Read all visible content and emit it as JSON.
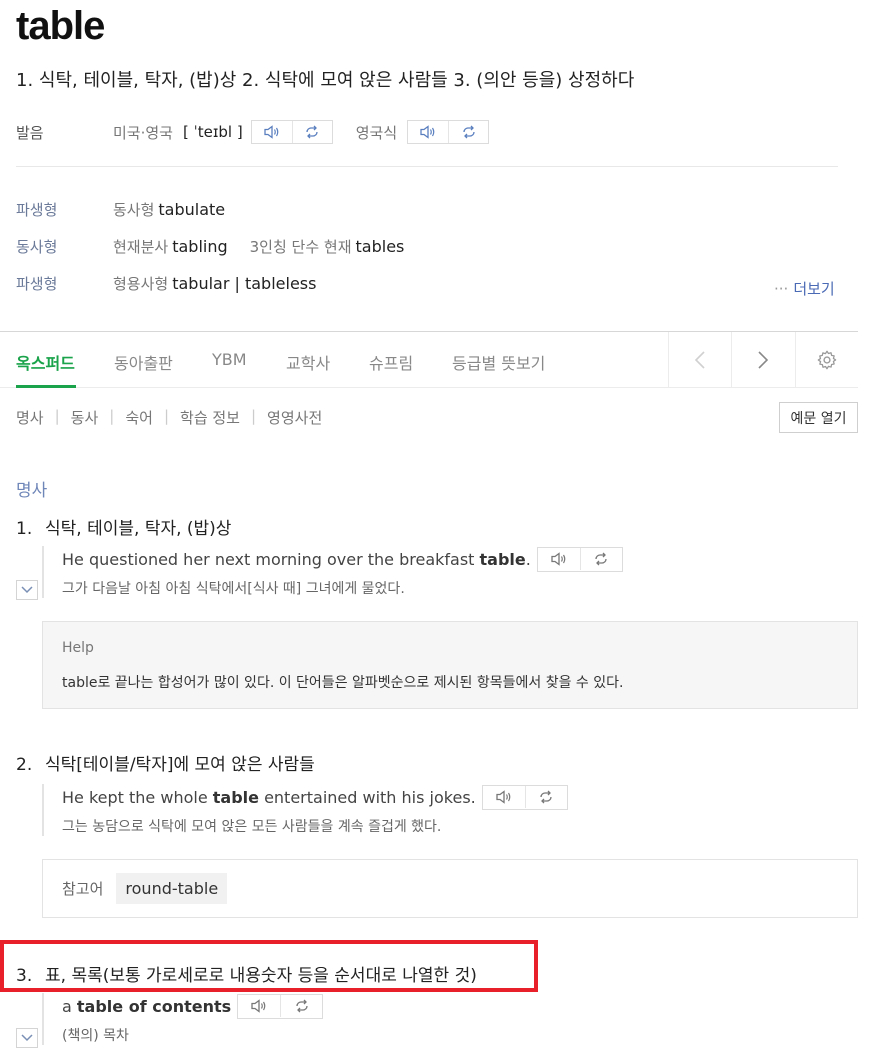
{
  "entry": {
    "word": "table",
    "summary": "1. 식탁, 테이블, 탁자, (밥)상 2. 식탁에 모여 앉은 사람들 3. (의안 등을) 상정하다"
  },
  "pronunciation": {
    "label": "발음",
    "us_uk_label": "미국·영국",
    "ipa": "[ ˈteɪbl ]",
    "british_label": "영국식"
  },
  "forms": [
    {
      "label": "파생형",
      "items": [
        {
          "type": "동사형",
          "value": "tabulate"
        }
      ]
    },
    {
      "label": "동사형",
      "items": [
        {
          "type": "현재분사",
          "value": "tabling"
        },
        {
          "type": "3인칭 단수 현재",
          "value": "tables"
        }
      ]
    },
    {
      "label": "파생형",
      "items": [
        {
          "type": "형용사형",
          "value": "tabular | tableless"
        }
      ]
    }
  ],
  "more_label": "더보기",
  "more_dots": "···",
  "tabs": [
    "옥스퍼드",
    "동아출판",
    "YBM",
    "교학사",
    "슈프림",
    "등급별 뜻보기"
  ],
  "subnav": [
    "명사",
    "동사",
    "숙어",
    "학습 정보",
    "영영사전"
  ],
  "subnav_separator": "|",
  "example_toggle": "예문 열기",
  "part_of_speech": "명사",
  "senses": [
    {
      "num": "1.",
      "text": "식탁, 테이블, 탁자, (밥)상",
      "example_before": "He questioned her next morning over the breakfast ",
      "example_bold": "table",
      "example_after": ".",
      "translation": "그가 다음날 아침 아침 식탁에서[식사 때] 그녀에게 물었다."
    },
    {
      "num": "2.",
      "text": "식탁[테이블/탁자]에 모여 앉은 사람들",
      "example_before": "He kept the whole ",
      "example_bold": "table",
      "example_after": " entertained with his jokes.",
      "translation": "그는 농담으로 식탁에 모여 앉은 모든 사람들을 계속 즐겁게 했다."
    },
    {
      "num": "3.",
      "text": "표, 목록(보통 가로세로로 내용숫자 등을 순서대로 나열한 것)",
      "example_before": "a ",
      "example_bold": "table of contents",
      "example_after": "",
      "translation": "(책의) 목차"
    }
  ],
  "help": {
    "title": "Help",
    "text": "table로 끝나는 합성어가 많이 있다. 이 단어들은 알파벳순으로 제시된 항목들에서 찾을 수 있다."
  },
  "reference": {
    "label": "참고어",
    "chip": "round-table"
  },
  "colors": {
    "accent_green": "#1aa34a",
    "highlight_red": "#e8202a",
    "link_blue": "#4a6ab5"
  },
  "icons": [
    "speaker-icon",
    "repeat-icon",
    "chevron-left-icon",
    "chevron-right-icon",
    "gear-icon",
    "chevron-down-icon"
  ]
}
